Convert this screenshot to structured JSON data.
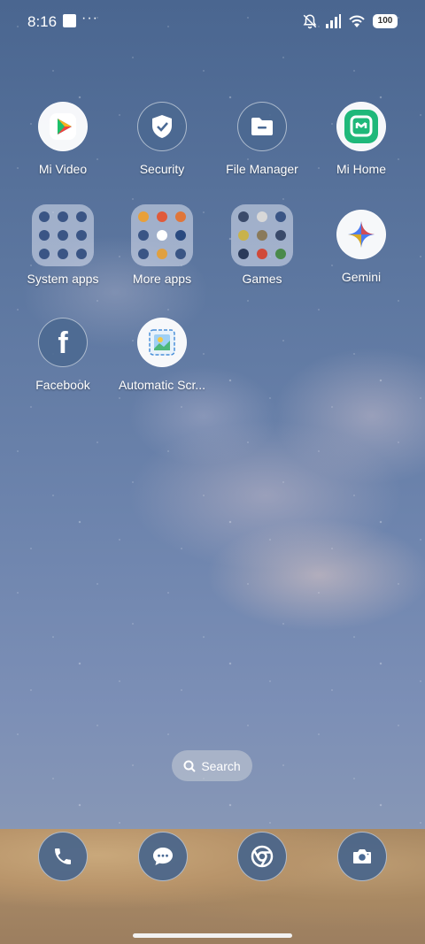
{
  "status_bar": {
    "time": "8:16",
    "battery": "100"
  },
  "apps": {
    "mi_video": "Mi Video",
    "security": "Security",
    "file_manager": "File Manager",
    "mi_home": "Mi Home",
    "system_apps": "System apps",
    "more_apps": "More apps",
    "games": "Games",
    "gemini": "Gemini",
    "facebook": "Facebook",
    "automatic_scr": "Automatic Scr..."
  },
  "search": {
    "label": "Search"
  },
  "dock": [
    "phone-icon",
    "messages-icon",
    "chrome-icon",
    "camera-icon"
  ],
  "colors": {
    "wallpaper": "#5d77a0",
    "mi_home_green": "#1fb87a"
  }
}
